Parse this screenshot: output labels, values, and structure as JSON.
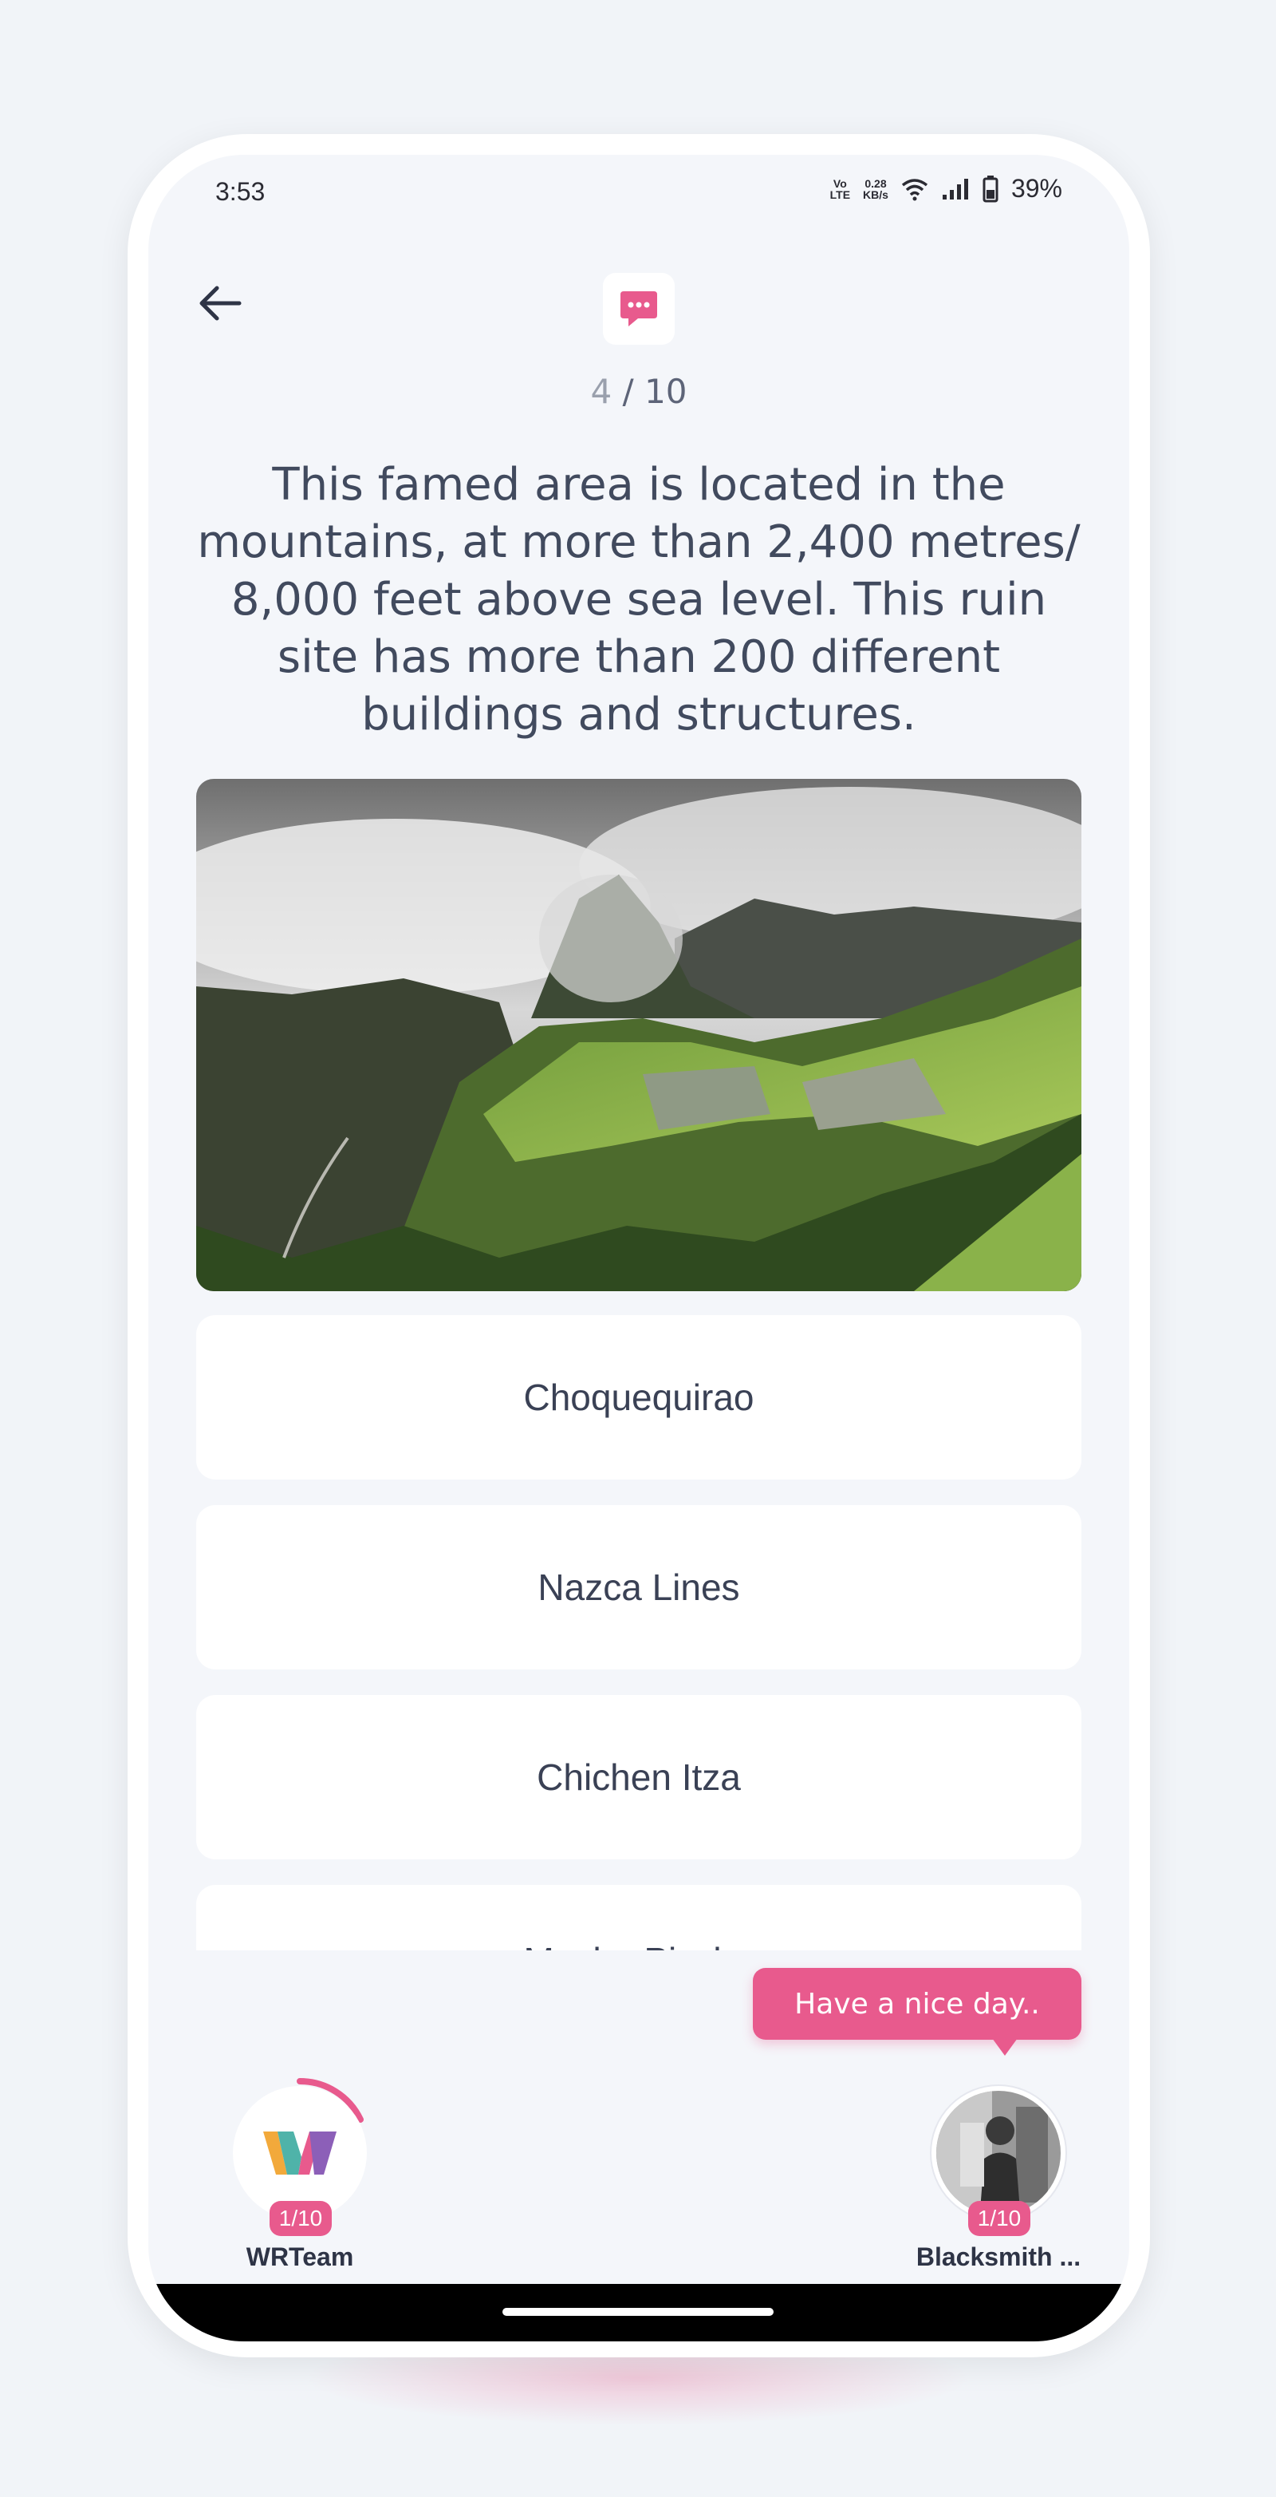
{
  "status_bar": {
    "time": "3:53",
    "volte": "Vo\nLTE",
    "speed": "0.28\nKB/s",
    "battery": "39%"
  },
  "header": {
    "back_icon": "arrow-left-icon",
    "chat_icon": "chat-bubble-icon",
    "counter_current": "4",
    "counter_sep": " / ",
    "counter_total": "10"
  },
  "question": {
    "text": "This famed area is located in the mountains, at more than 2,400 metres/ 8,000 feet above sea level. This ruin site has more than 200 different buildings and structures."
  },
  "options": [
    {
      "label": "Choquequirao"
    },
    {
      "label": "Nazca Lines"
    },
    {
      "label": "Chichen Itza"
    },
    {
      "label": "Machu Picchu"
    }
  ],
  "tooltip": {
    "text": "Have a nice day.."
  },
  "players": [
    {
      "name": "WRTeam",
      "score": "1/10"
    },
    {
      "name": "Blacksmith ...",
      "score": "1/10"
    }
  ],
  "colors": {
    "accent": "#e85a8d",
    "background": "#f4f6fa",
    "text": "#414a5e"
  }
}
